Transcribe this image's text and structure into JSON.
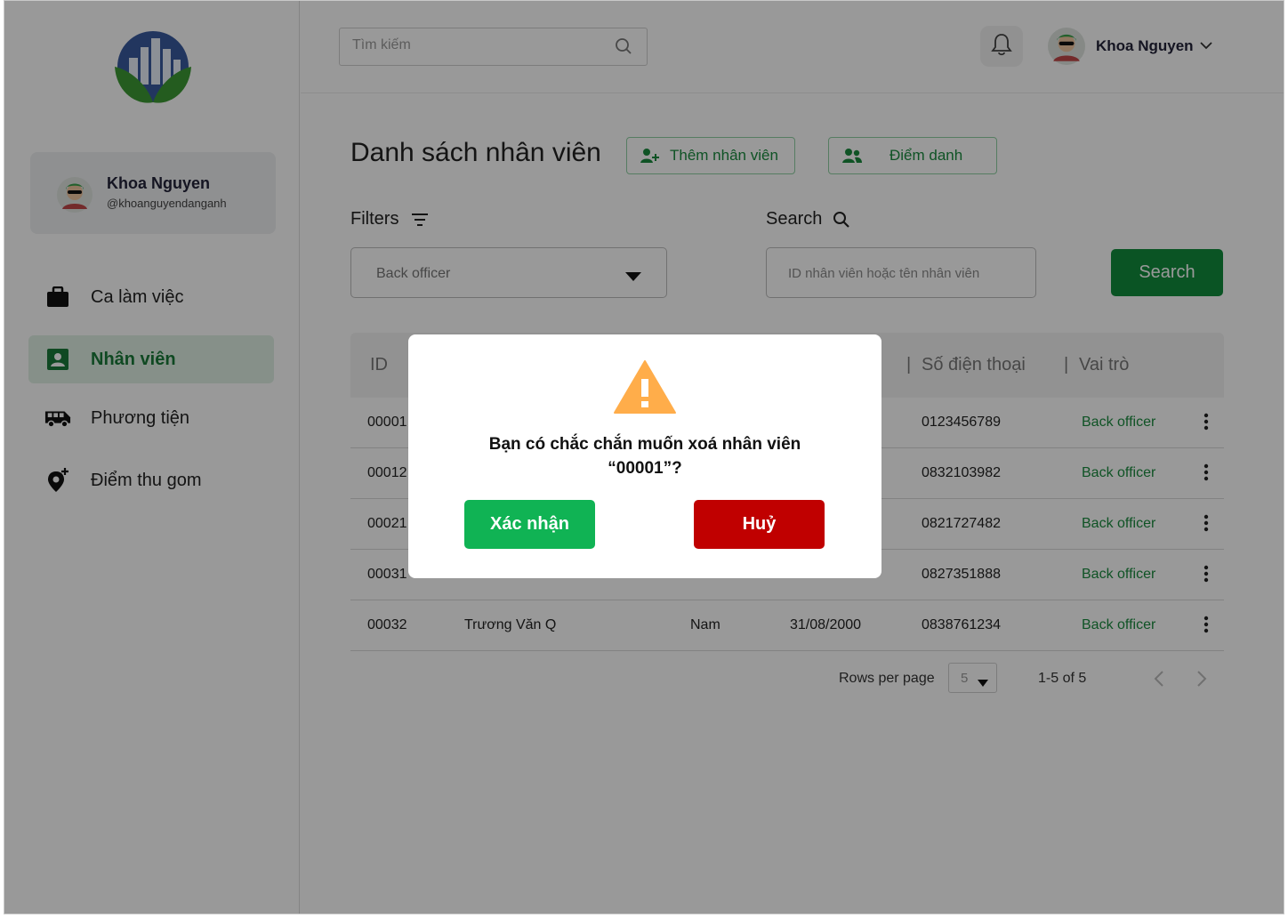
{
  "sidebar": {
    "user": {
      "name": "Khoa Nguyen",
      "handle": "@khoanguyendanganh"
    },
    "items": [
      {
        "label": "Ca làm việc",
        "icon": "briefcase-icon"
      },
      {
        "label": "Nhân viên",
        "icon": "contact-card-icon"
      },
      {
        "label": "Phương tiện",
        "icon": "van-icon"
      },
      {
        "label": "Điểm thu gom",
        "icon": "location-add-icon"
      }
    ]
  },
  "header": {
    "search_placeholder": "Tìm kiếm",
    "user_name": "Khoa Nguyen"
  },
  "main": {
    "title": "Danh sách nhân viên",
    "add_button": "Thêm nhân viên",
    "attendance_button": "Điểm danh",
    "filters_label": "Filters",
    "search_label": "Search",
    "filter_value": "Back officer",
    "id_placeholder": "ID nhân viên hoặc tên nhân viên",
    "search_button": "Search"
  },
  "table": {
    "headers": {
      "id": "ID",
      "phone": "Số điện thoại",
      "role": "Vai trò"
    },
    "rows": [
      {
        "id": "00001",
        "name": "",
        "gender": "",
        "dob": "",
        "phone": "0123456789",
        "role": "Back officer"
      },
      {
        "id": "00012",
        "name": "",
        "gender": "",
        "dob": "",
        "phone": "0832103982",
        "role": "Back officer"
      },
      {
        "id": "00021",
        "name": "",
        "gender": "",
        "dob": "",
        "phone": "0821727482",
        "role": "Back officer"
      },
      {
        "id": "00031",
        "name": "",
        "gender": "",
        "dob": "",
        "phone": "0827351888",
        "role": "Back officer"
      },
      {
        "id": "00032",
        "name": "Trương Văn Q",
        "gender": "Nam",
        "dob": "31/08/2000",
        "phone": "0838761234",
        "role": "Back officer"
      }
    ]
  },
  "pagination": {
    "rows_per_page_label": "Rows per page",
    "rows_per_page": "5",
    "range": "1-5 of 5"
  },
  "modal": {
    "message_line1": "Bạn có chắc chắn muốn xoá nhân viên",
    "message_line2": "“00001”?",
    "confirm": "Xác nhận",
    "cancel": "Huỷ",
    "warning_color": "#ffad4a"
  },
  "colors": {
    "primary_green": "#118c3d",
    "confirm_green": "#10b354",
    "cancel_red": "#c00000"
  }
}
